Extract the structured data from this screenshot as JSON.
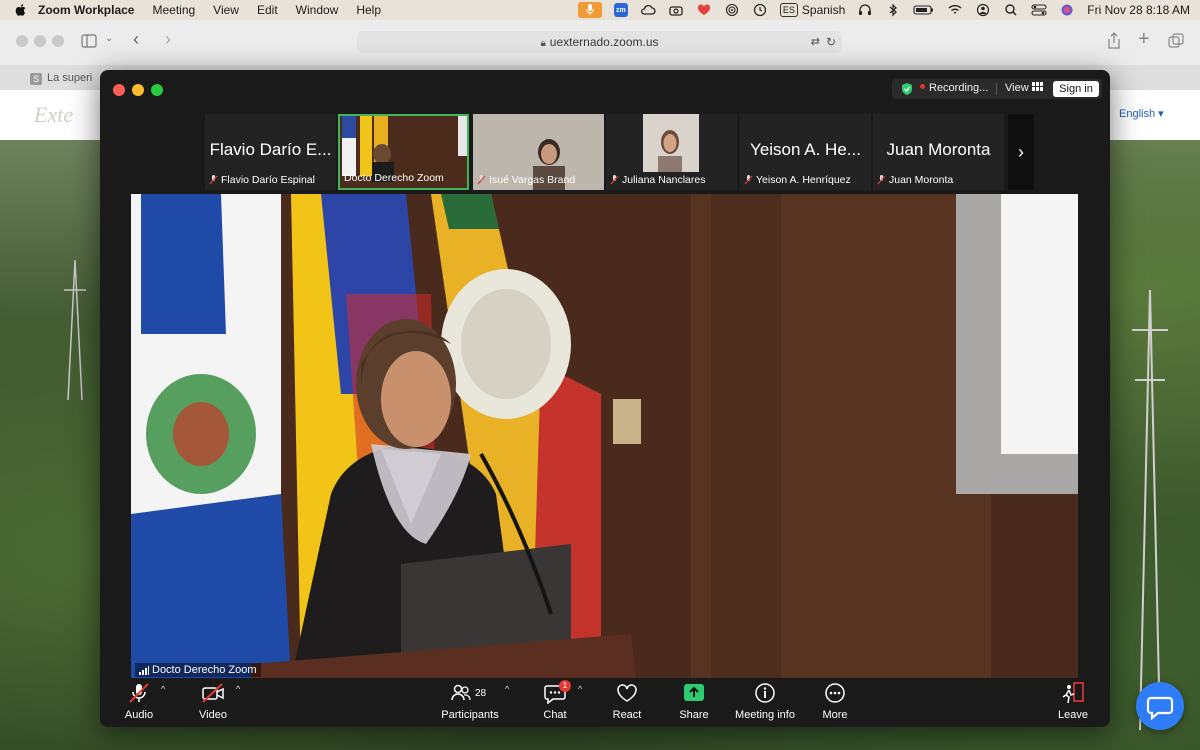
{
  "menubar": {
    "app_name": "Zoom Workplace",
    "menus": [
      "Meeting",
      "View",
      "Edit",
      "Window",
      "Help"
    ],
    "input_source": "Spanish",
    "input_badge": "ES",
    "zoom_badge": "zm",
    "datetime": "Fri Nov 28  8:18 AM"
  },
  "browser": {
    "url": "uexternado.zoom.us",
    "tab_title": "La superi",
    "tab_favicon": "S"
  },
  "webpage": {
    "language": "English"
  },
  "zoom": {
    "recording_label": "Recording...",
    "view_label": "View",
    "signin_label": "Sign in",
    "thumbnails": [
      {
        "big_name": "Flavio Darío E...",
        "caption": "Flavio Darío Espinal",
        "muted": true
      },
      {
        "big_name": "",
        "caption": "Docto Derecho Zoom",
        "muted": false,
        "active": true
      },
      {
        "big_name": "",
        "caption": "Isué Vargas Brand",
        "muted": true
      },
      {
        "big_name": "",
        "caption": "Juliana Nanclares",
        "muted": true
      },
      {
        "big_name": "Yeison A. He...",
        "caption": "Yeison A. Henríquez",
        "muted": true
      },
      {
        "big_name": "Juan Moronta",
        "caption": "Juan Moronta",
        "muted": true
      }
    ],
    "stage_name": "Docto Derecho Zoom",
    "toolbar": {
      "audio": "Audio",
      "video": "Video",
      "participants": "Participants",
      "participants_count": "28",
      "chat": "Chat",
      "chat_badge": "1",
      "react": "React",
      "share": "Share",
      "meeting_info": "Meeting info",
      "more": "More",
      "leave": "Leave"
    }
  },
  "colors": {
    "share_green": "#2ecc71",
    "active_border": "#3fb45a",
    "mute_red": "#e53935",
    "chat_bubble": "#2f7df6"
  }
}
